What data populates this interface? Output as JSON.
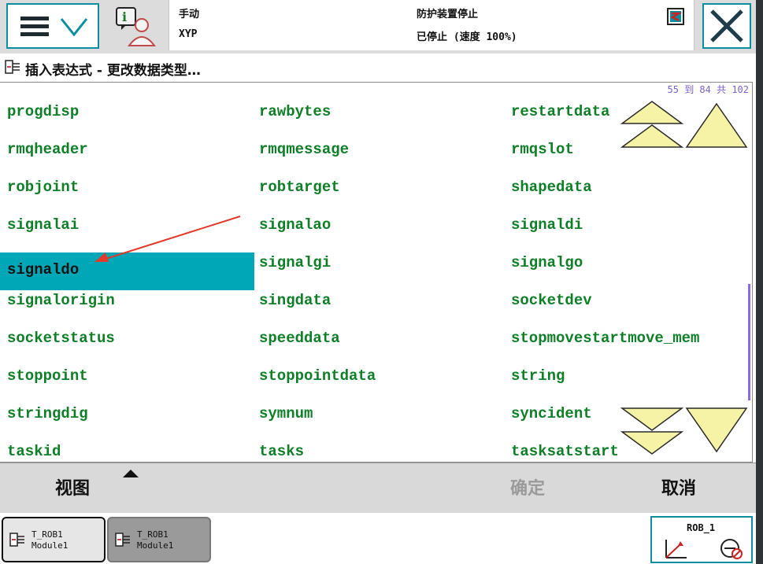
{
  "status": {
    "mode": "手动",
    "system": "XYP",
    "safety": "防护装置停止",
    "state": "已停止 (速度 100%)"
  },
  "dialog": {
    "title": "插入表达式 - 更改数据类型…",
    "counter": "55 到 84 共 102"
  },
  "list": {
    "selected": "signaldo",
    "rows": [
      [
        "progdisp",
        "rawbytes",
        "restartdata"
      ],
      [
        "rmqheader",
        "rmqmessage",
        "rmqslot"
      ],
      [
        "robjoint",
        "robtarget",
        "shapedata"
      ],
      [
        "signalai",
        "signalao",
        "signaldi"
      ],
      [
        "signaldo",
        "signalgi",
        "signalgo"
      ],
      [
        "signalorigin",
        "singdata",
        "socketdev"
      ],
      [
        "socketstatus",
        "speeddata",
        "stopmovestartmove_mem"
      ],
      [
        "stoppoint",
        "stoppointdata",
        "string"
      ],
      [
        "stringdig",
        "symnum",
        "syncident"
      ],
      [
        "taskid",
        "tasks",
        "tasksatstart"
      ]
    ]
  },
  "commands": {
    "view": "视图",
    "ok": "确定",
    "cancel": "取消"
  },
  "tasks": [
    {
      "line1": "T_ROB1",
      "line2": "Module1"
    },
    {
      "line1": "T_ROB1",
      "line2": "Module1"
    }
  ],
  "quickset": {
    "label": "ROB_1"
  },
  "colors": {
    "accent": "#0a8fa0",
    "item_text": "#0e7e27",
    "selected_bg": "#00a7b7",
    "scroll_button": "#f6f3a6"
  }
}
